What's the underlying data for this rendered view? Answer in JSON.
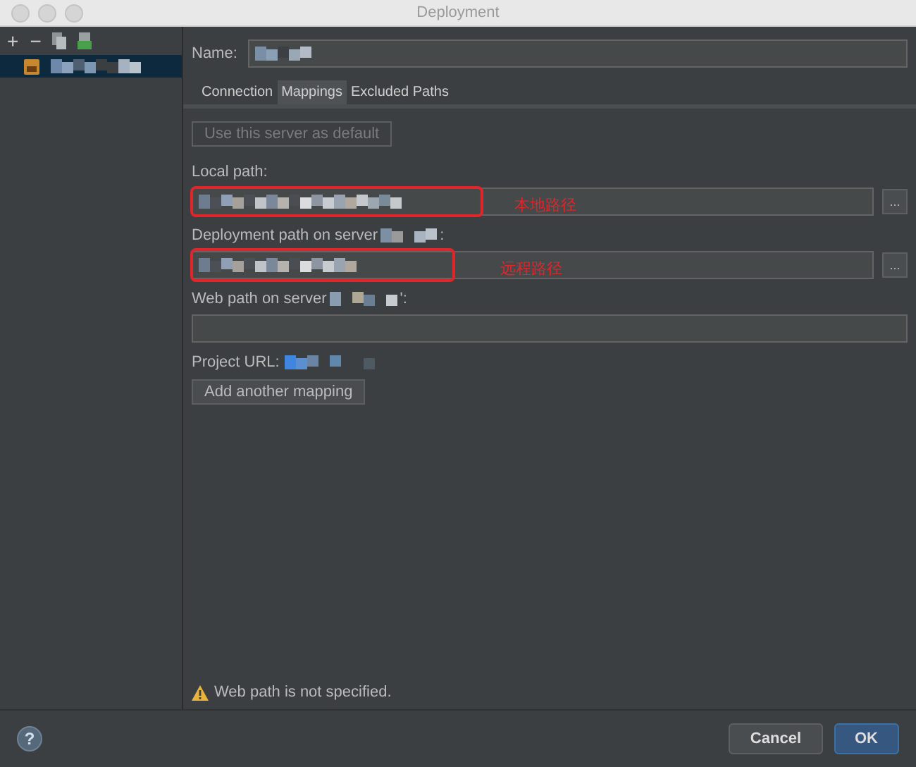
{
  "window": {
    "title": "Deployment"
  },
  "toolbar": [
    "+",
    "−"
  ],
  "sidebar": {
    "items": [
      {
        "selected": true
      }
    ]
  },
  "name_label": "Name:",
  "tabs": [
    {
      "label": "Connection",
      "selected": false
    },
    {
      "label": "Mappings",
      "selected": true
    },
    {
      "label": "Excluded Paths",
      "selected": false
    }
  ],
  "default_button": {
    "label": "Use this server as default",
    "disabled": true
  },
  "local_path": {
    "label": "Local path:",
    "browse": "...",
    "annotation": "本地路径"
  },
  "deployment_path": {
    "label": "Deployment path on server",
    "suffix": ":",
    "browse": "...",
    "annotation": "远程路径"
  },
  "web_path": {
    "label": "Web path on server",
    "suffix": "':"
  },
  "project_url": {
    "label": "Project URL:"
  },
  "add_mapping_button": "Add another mapping",
  "warning": "Web path is not specified.",
  "help": "?",
  "buttons": [
    {
      "label": "Cancel",
      "primary": false
    },
    {
      "label": "OK",
      "primary": true
    }
  ]
}
